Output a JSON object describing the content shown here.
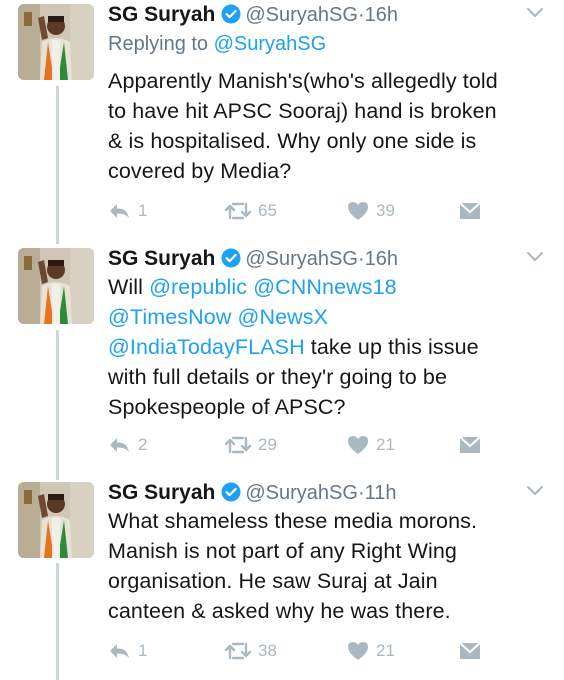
{
  "colors": {
    "text": "#14171a",
    "muted": "#657786",
    "link": "#1da1f2",
    "action": "#aab8c2",
    "thread_line": "#ccd6dd"
  },
  "tweets": [
    {
      "name": "SG Suryah",
      "handle": "@SuryahSG",
      "separator": "·",
      "time": "16h",
      "replying_prefix": "Replying to",
      "replying_handle": "@SuryahSG",
      "lines": [
        "Apparently Manish's(who's allegedly told",
        "to have hit APSC Sooraj) hand is broken",
        "& is hospitalised. Why only one side is",
        "covered by Media?"
      ],
      "replies": "1",
      "retweets": "65",
      "likes": "39"
    },
    {
      "name": "SG Suryah",
      "handle": "@SuryahSG",
      "separator": "·",
      "time": "16h",
      "segments": {
        "l1_text": "Will ",
        "m_republic": "@republic",
        "m_cnn": "@CNNnews18",
        "m_timesnow": "@TimesNow",
        "m_newsx": "@NewsX",
        "m_indiatoday": "@IndiaTodayFLASH",
        "l3_text": " take up this issue",
        "l4_text": "with full details or they'r going to be",
        "l5_text": "Spokespeople of APSC?"
      },
      "replies": "2",
      "retweets": "29",
      "likes": "21"
    },
    {
      "name": "SG Suryah",
      "handle": "@SuryahSG",
      "separator": "·",
      "time": "11h",
      "lines": [
        "What shameless these media morons.",
        "Manish is not part of any Right Wing",
        "organisation. He saw Suraj at Jain",
        "canteen & asked why he was there."
      ],
      "replies": "1",
      "retweets": "38",
      "likes": "21"
    }
  ]
}
